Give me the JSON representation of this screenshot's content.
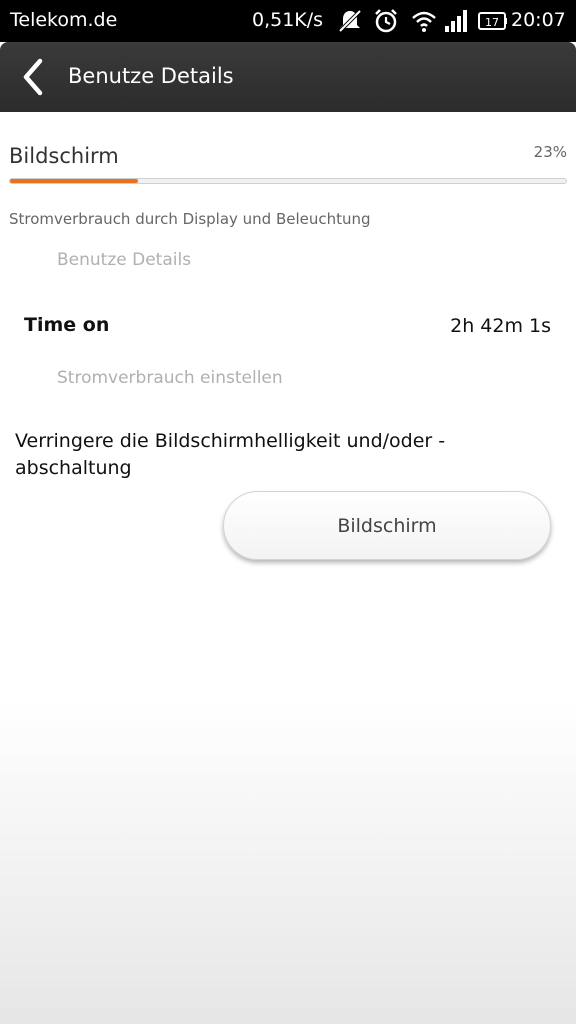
{
  "statusbar": {
    "carrier": "Telekom.de",
    "speed": "0,51K/s",
    "battery_level": "17",
    "time": "20:07",
    "icons": [
      "notifications-muted-icon",
      "alarm-icon",
      "wifi-icon",
      "signal-icon",
      "battery-icon"
    ]
  },
  "header": {
    "title": "Benutze Details",
    "back_icon": "chevron-left-icon"
  },
  "usage": {
    "label": "Bildschirm",
    "percent": "23%",
    "progress_fraction": 0.23,
    "progress_color": "#e8731f",
    "description": "Stromverbrauch durch Display und Beleuchtung"
  },
  "links": {
    "details": "Benutze Details",
    "settings": "Stromverbrauch einstellen"
  },
  "time_on": {
    "label": "Time on",
    "value": "2h 42m 1s"
  },
  "advice": {
    "text": "Verringere die Bildschirmhelligkeit und/oder -abschaltung"
  },
  "action": {
    "button_label": "Bildschirm"
  }
}
